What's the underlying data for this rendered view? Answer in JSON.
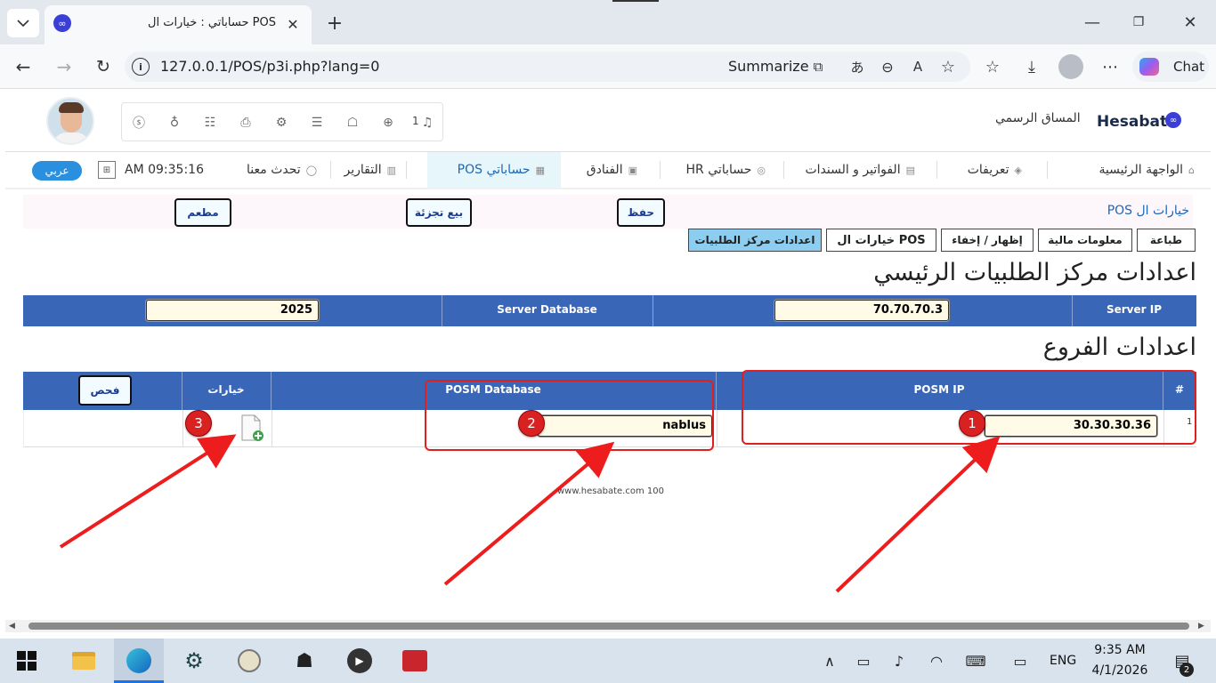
{
  "browser": {
    "tab_title": "حساباتي : خيارات ال POS",
    "url": "127.0.0.1/POS/p3i.php?lang=0",
    "summarize_label": "Summarize",
    "chat_label": "Chat"
  },
  "header": {
    "brand": "Hesabate",
    "user_name": "المساق الرسمي",
    "notif_count": "1"
  },
  "nav": {
    "items": [
      {
        "label": "الواجهة الرئيسية"
      },
      {
        "label": "تعريفات"
      },
      {
        "label": "الفواتير و السندات"
      },
      {
        "label": "حساباتي HR"
      },
      {
        "label": "الفنادق"
      },
      {
        "label": "حساباتي POS"
      },
      {
        "label": "التقارير"
      },
      {
        "label": "تحدث معنا"
      }
    ],
    "time": "AM 09:35:16",
    "lang_button": "عربي"
  },
  "toolbar": {
    "breadcrumb": "خيارات ال POS",
    "save": "حفظ",
    "retail": "بيع تجزئة",
    "restaurant": "مطعم"
  },
  "tabs": [
    "طباعة",
    "معلومات مالية",
    "إظهار / إخفاء",
    "خيارات ال POS",
    "اعدادات مركز الطلبيات"
  ],
  "main_center": {
    "heading": "اعدادات مركز الطلبيات الرئيسي",
    "server_ip_label": "Server IP",
    "server_ip_value": "70.70.70.3",
    "server_db_label": "Server Database",
    "server_db_value": "2025"
  },
  "branches": {
    "heading": "اعدادات الفروع",
    "col_num": "#",
    "col_ip": "POSM IP",
    "col_db": "POSM Database",
    "col_options": "خيارات",
    "check_button": "فحص",
    "rows": [
      {
        "num": "1",
        "ip": "30.30.30.36",
        "db": "nablus"
      }
    ]
  },
  "footer": {
    "text": "www.hesabate.com 100"
  },
  "annotations": {
    "badge1": "1",
    "badge2": "2",
    "badge3": "3"
  },
  "taskbar": {
    "lang": "ENG",
    "time": "9:35 AM",
    "date": "4/1/2026",
    "notif_count": "2"
  },
  "colors": {
    "accent": "#3a66b7",
    "active_tab": "#8ccdf0",
    "annotation": "#e02020"
  }
}
